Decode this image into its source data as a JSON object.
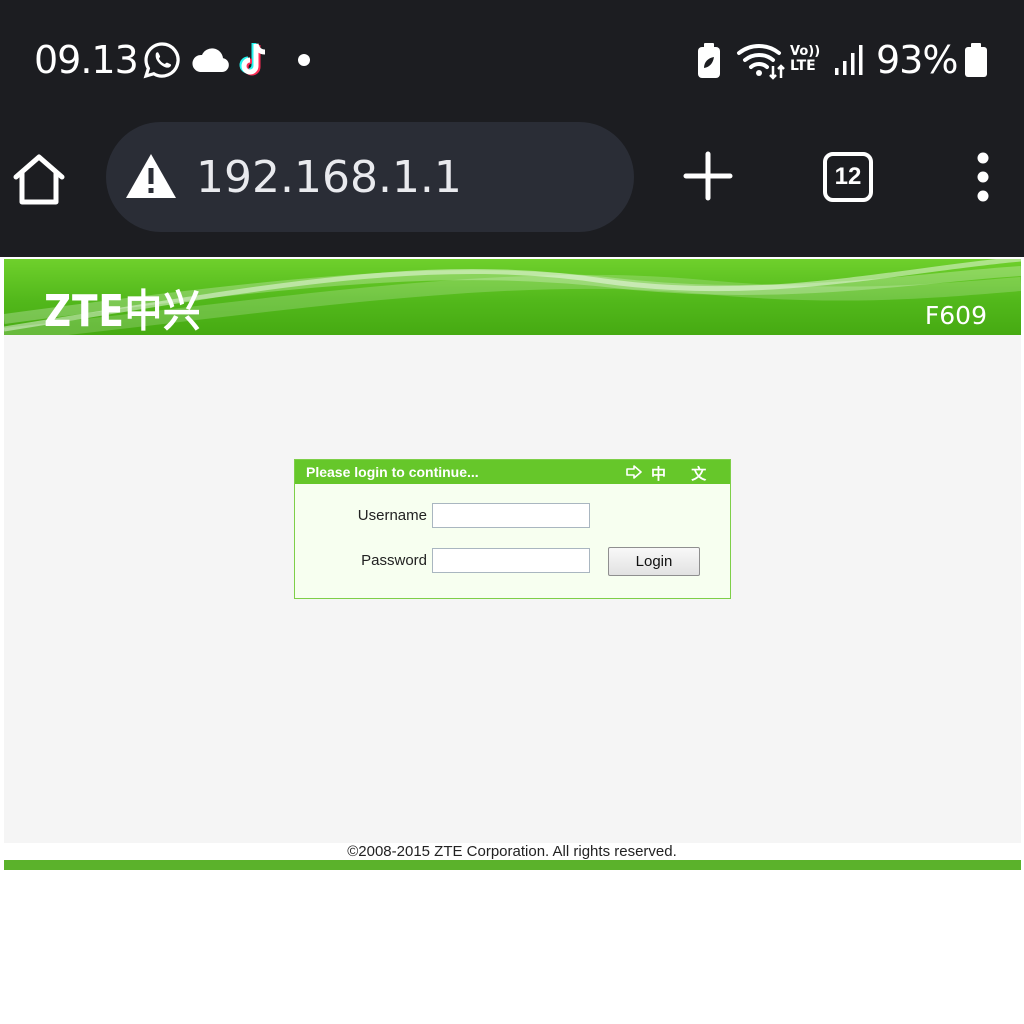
{
  "status_bar": {
    "time": "09.13",
    "notification_icons": [
      "whatsapp-icon",
      "cloud-icon",
      "tiktok-icon",
      "dot-icon"
    ],
    "system_icons": [
      "battery-saver-icon",
      "wifi-icon",
      "volte-icon",
      "signal-icon",
      "battery-icon"
    ],
    "volte_label_top": "Vo))",
    "volte_label_bottom": "LTE",
    "battery_percent": "93%"
  },
  "browser": {
    "url": "192.168.1.1",
    "security_icon": "warning-icon",
    "tab_count": "12",
    "colors": {
      "chrome_bg": "#1c1d21",
      "urlbar_bg": "#2a2d36"
    }
  },
  "router_page": {
    "brand": "ZTE中兴",
    "model": "F609",
    "login": {
      "title": "Please login to continue...",
      "language_link": "中 文",
      "username_label": "Username",
      "username_value": "",
      "password_label": "Password",
      "password_value": "",
      "login_button": "Login"
    },
    "footer": "©2008-2015 ZTE Corporation. All rights reserved.",
    "colors": {
      "brand_green": "#52b81b",
      "header_green": "#66c72a",
      "footer_green": "#5bb22b"
    }
  }
}
